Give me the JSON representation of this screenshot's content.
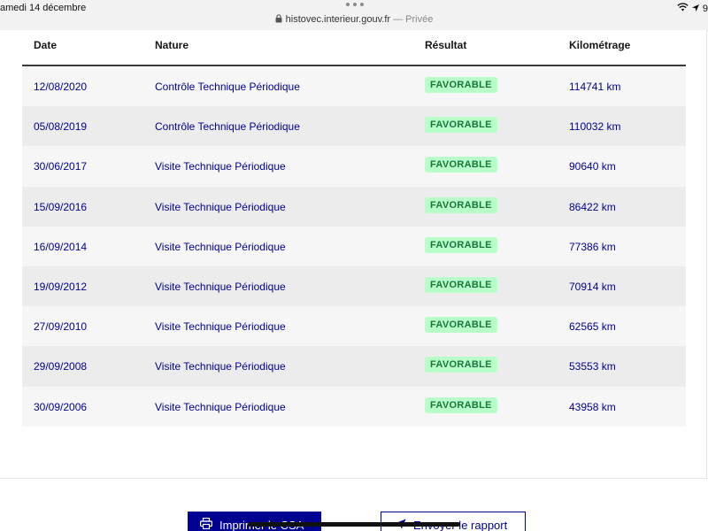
{
  "status_bar": {
    "time": "amedi 14 décembre",
    "url": "histovec.interieur.gouv.fr",
    "private_label": " — Privée",
    "battery_text": "9"
  },
  "table": {
    "headers": {
      "date": "Date",
      "nature": "Nature",
      "result": "Résultat",
      "mileage": "Kilométrage"
    },
    "rows": [
      {
        "date": "12/08/2020",
        "nature": "Contrôle Technique Périodique",
        "result": "FAVORABLE",
        "mileage": "114741 km"
      },
      {
        "date": "05/08/2019",
        "nature": "Contrôle Technique Périodique",
        "result": "FAVORABLE",
        "mileage": "110032 km"
      },
      {
        "date": "30/06/2017",
        "nature": "Visite Technique Périodique",
        "result": "FAVORABLE",
        "mileage": "90640 km"
      },
      {
        "date": "15/09/2016",
        "nature": "Visite Technique Périodique",
        "result": "FAVORABLE",
        "mileage": "86422 km"
      },
      {
        "date": "16/09/2014",
        "nature": "Visite Technique Périodique",
        "result": "FAVORABLE",
        "mileage": "77386 km"
      },
      {
        "date": "19/09/2012",
        "nature": "Visite Technique Périodique",
        "result": "FAVORABLE",
        "mileage": "70914 km"
      },
      {
        "date": "27/09/2010",
        "nature": "Visite Technique Périodique",
        "result": "FAVORABLE",
        "mileage": "62565 km"
      },
      {
        "date": "29/09/2008",
        "nature": "Visite Technique Périodique",
        "result": "FAVORABLE",
        "mileage": "53553 km"
      },
      {
        "date": "30/09/2006",
        "nature": "Visite Technique Périodique",
        "result": "FAVORABLE",
        "mileage": "43958 km"
      }
    ]
  },
  "actions": {
    "print_label": "Imprimer le CSA",
    "send_label": "Envoyer le rapport"
  },
  "colors": {
    "primary": "#000091",
    "badge_bg": "#b8fec9",
    "badge_text": "#18753c"
  },
  "icons": {
    "print": "printer-icon",
    "send": "send-icon",
    "lock": "lock-icon",
    "wifi": "wifi-icon"
  }
}
